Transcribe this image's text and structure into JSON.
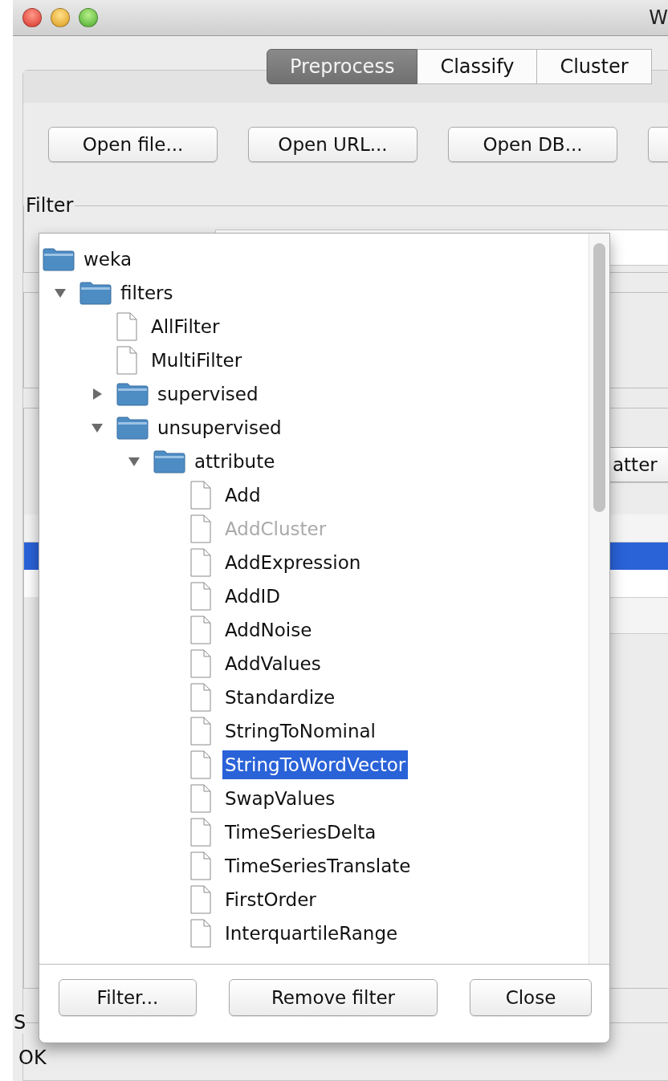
{
  "window": {
    "title": "W"
  },
  "tabs": [
    {
      "label": "Preprocess",
      "selected": true
    },
    {
      "label": "Classify",
      "selected": false
    },
    {
      "label": "Cluster",
      "selected": false
    }
  ],
  "toolbar": {
    "buttons": [
      "Open file...",
      "Open URL...",
      "Open DB..."
    ]
  },
  "filter": {
    "label": "Filter"
  },
  "attributes": {
    "buttons": [
      "atter"
    ],
    "rows": [
      {
        "selected": true
      },
      {
        "selected": false
      }
    ]
  },
  "status": {
    "label": "S",
    "message": "OK"
  },
  "dialog": {
    "tree": [
      {
        "label": "weka",
        "kind": "folder",
        "selected": false,
        "disabled": false,
        "children": [
          {
            "label": "filters",
            "kind": "folder",
            "expanded": true,
            "selected": false,
            "disabled": false,
            "children": [
              {
                "label": "AllFilter",
                "kind": "leaf",
                "selected": false,
                "disabled": false
              },
              {
                "label": "MultiFilter",
                "kind": "leaf",
                "selected": false,
                "disabled": false
              },
              {
                "label": "supervised",
                "kind": "folder",
                "expanded": false,
                "selected": false,
                "disabled": false
              },
              {
                "label": "unsupervised",
                "kind": "folder",
                "expanded": true,
                "selected": false,
                "disabled": false,
                "children": [
                  {
                    "label": "attribute",
                    "kind": "folder",
                    "expanded": true,
                    "selected": false,
                    "disabled": false,
                    "children": [
                      {
                        "label": "Add",
                        "kind": "leaf",
                        "selected": false,
                        "disabled": false
                      },
                      {
                        "label": "AddCluster",
                        "kind": "leaf",
                        "selected": false,
                        "disabled": true
                      },
                      {
                        "label": "AddExpression",
                        "kind": "leaf",
                        "selected": false,
                        "disabled": false
                      },
                      {
                        "label": "AddID",
                        "kind": "leaf",
                        "selected": false,
                        "disabled": false
                      },
                      {
                        "label": "AddNoise",
                        "kind": "leaf",
                        "selected": false,
                        "disabled": false
                      },
                      {
                        "label": "AddValues",
                        "kind": "leaf",
                        "selected": false,
                        "disabled": false
                      },
                      {
                        "label": "Standardize",
                        "kind": "leaf",
                        "selected": false,
                        "disabled": false
                      },
                      {
                        "label": "StringToNominal",
                        "kind": "leaf",
                        "selected": false,
                        "disabled": false
                      },
                      {
                        "label": "StringToWordVector",
                        "kind": "leaf",
                        "selected": true,
                        "disabled": false
                      },
                      {
                        "label": "SwapValues",
                        "kind": "leaf",
                        "selected": false,
                        "disabled": false
                      },
                      {
                        "label": "TimeSeriesDelta",
                        "kind": "leaf",
                        "selected": false,
                        "disabled": false
                      },
                      {
                        "label": "TimeSeriesTranslate",
                        "kind": "leaf",
                        "selected": false,
                        "disabled": false
                      },
                      {
                        "label": "FirstOrder",
                        "kind": "leaf",
                        "selected": false,
                        "disabled": false
                      },
                      {
                        "label": "InterquartileRange",
                        "kind": "leaf",
                        "selected": false,
                        "disabled": false
                      }
                    ]
                  }
                ]
              }
            ]
          }
        ]
      }
    ],
    "buttons": [
      "Filter...",
      "Remove filter",
      "Close"
    ]
  }
}
